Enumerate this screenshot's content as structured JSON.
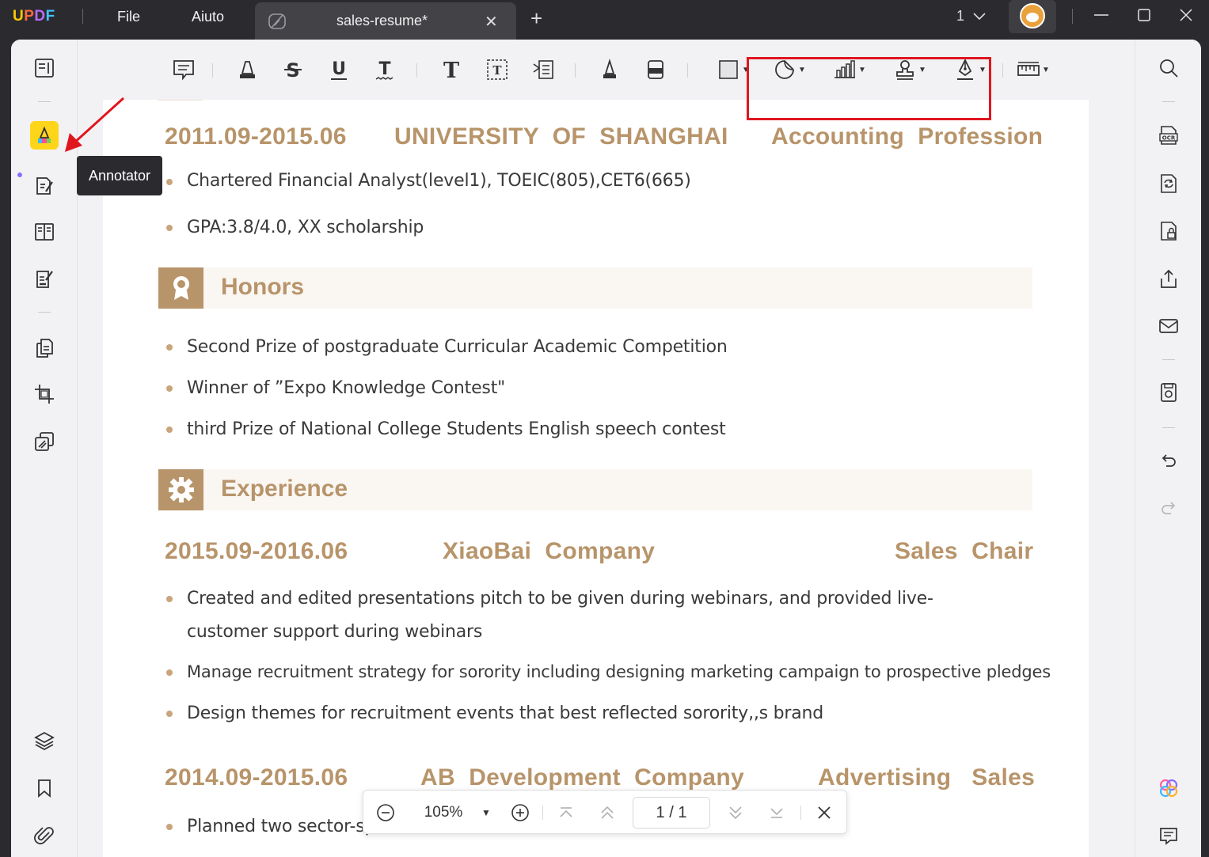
{
  "app": {
    "logo": "UPDF",
    "menus": [
      "File",
      "Aiuto"
    ],
    "tab_title": "sales-resume*",
    "tab_close": "✕",
    "new_tab": "+",
    "page_indicator": "1",
    "window_controls": [
      "minimize",
      "maximize",
      "close"
    ]
  },
  "left_rail": {
    "items": [
      {
        "name": "reader",
        "icon": "reader-icon"
      },
      {
        "name": "annotator",
        "icon": "highlighter-icon",
        "active": true
      },
      {
        "name": "edit-pdf",
        "icon": "edit-pdf-icon"
      },
      {
        "name": "page-layout",
        "icon": "page-layout-icon"
      },
      {
        "name": "fill-sign",
        "icon": "fill-sign-icon"
      },
      {
        "name": "organize-pages",
        "icon": "organize-pages-icon"
      },
      {
        "name": "crop",
        "icon": "crop-icon"
      },
      {
        "name": "watermark",
        "icon": "watermark-icon"
      },
      {
        "name": "layers",
        "icon": "layers-icon"
      },
      {
        "name": "bookmark",
        "icon": "bookmark-icon"
      },
      {
        "name": "attachment",
        "icon": "paperclip-icon"
      }
    ],
    "tooltip": "Annotator"
  },
  "toolbar": {
    "tools": [
      "comment-icon",
      "highlight-icon",
      "strikethrough-icon",
      "underline-icon",
      "squiggly-icon",
      "text-icon",
      "text-box-icon",
      "text-callout-icon",
      "pencil-icon",
      "eraser-icon",
      "rectangle-icon",
      "sticker-icon",
      "chart-icon",
      "stamp-icon",
      "signature-icon",
      "measure-icon"
    ],
    "highlight_color": "#e0161f"
  },
  "right_rail": {
    "items": [
      "search-icon",
      "ocr-icon",
      "convert-icon",
      "protect-icon",
      "share-icon",
      "email-icon",
      "save-icon",
      "undo-icon",
      "redo-icon",
      "ai-icon",
      "comments-icon"
    ],
    "ocr_label": "OCR"
  },
  "document": {
    "education": {
      "dates": "2011.09-2015.06",
      "school": "UNIVERSITY  OF  SHANGHAI",
      "major": "Accounting  Profession",
      "bullets": [
        "Chartered Financial Analyst(level1), TOEIC(805),CET6(665)",
        "GPA:3.8/4.0, XX scholarship"
      ]
    },
    "honors": {
      "title": "Honors",
      "bullets": [
        "Second Prize of postgraduate Curricular Academic Competition",
        "Winner of ”Expo Knowledge Contest\"",
        "third Prize of National College Students  English speech contest"
      ]
    },
    "experience": {
      "title": "Experience",
      "jobs": [
        {
          "dates": "2015.09-2016.06",
          "company": "XiaoBai  Company",
          "role": "Sales  Chair",
          "bullets": [
            "Created and edited presentations pitch to be given during webinars, and provided live-",
            "customer support during webinars",
            "Manage recruitment strategy for sorority including designing marketing campaign to prospective pledges",
            "Design themes for recruitment events that best reflected sorority‚‚s brand"
          ]
        },
        {
          "dates": "2014.09-2015.06",
          "company": "AB  Development  Company",
          "role": "Advertising   Sales",
          "bullets": [
            "Planned two sector-sp"
          ]
        }
      ]
    },
    "accent_color": "#b8946a"
  },
  "page_nav": {
    "zoom": "105%",
    "page": "1 / 1"
  }
}
